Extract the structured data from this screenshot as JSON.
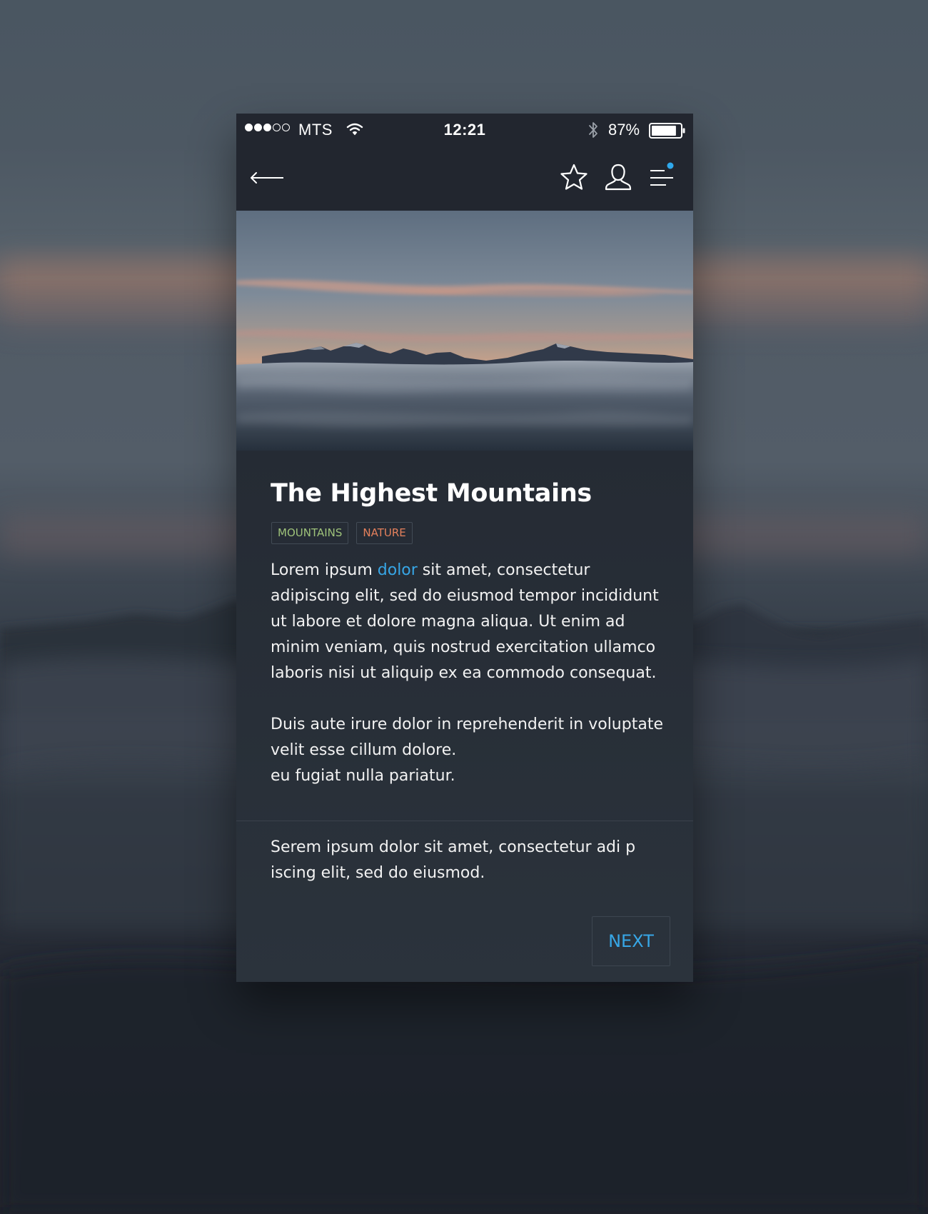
{
  "status_bar": {
    "signal_dots_filled": 3,
    "signal_dots_total": 5,
    "carrier": "MTS",
    "time": "12:21",
    "battery_percent": "87%",
    "battery_level": 0.87,
    "icons": [
      "wifi-icon",
      "bluetooth-icon",
      "battery-icon"
    ]
  },
  "nav": {
    "icons": [
      "arrow-left-icon",
      "star-icon",
      "user-icon",
      "menu-icon"
    ],
    "notification_dot_color": "#2fa8ec"
  },
  "article": {
    "title": "The Highest Mountains",
    "tags": [
      {
        "label": "MOUNTAINS",
        "color": "#9ec27a"
      },
      {
        "label": "NATURE",
        "color": "#e4805c"
      }
    ],
    "paragraph1": {
      "before_link": "Lorem ipsum ",
      "link": "dolor",
      "after_link": " sit amet, consectetur adipiscing elit, sed do eiusmod tempor incididunt ut labore et dolore magna aliqua. Ut enim ad minim veniam, quis nostrud exercitation ullamco laboris nisi ut aliquip ex ea commodo consequat."
    },
    "paragraph2": "Duis aute irure dolor in reprehenderit in voluptate velit esse cillum dolore.\n eu fugiat nulla pariatur.",
    "paragraph3": "Serem ipsum dolor sit amet, consectetur adi p iscing elit, sed do eiusmod."
  },
  "actions": {
    "next_label": "NEXT"
  },
  "colors": {
    "accent": "#37a6e6",
    "card_background": "#2a313b",
    "bar_background": "#22262f"
  }
}
